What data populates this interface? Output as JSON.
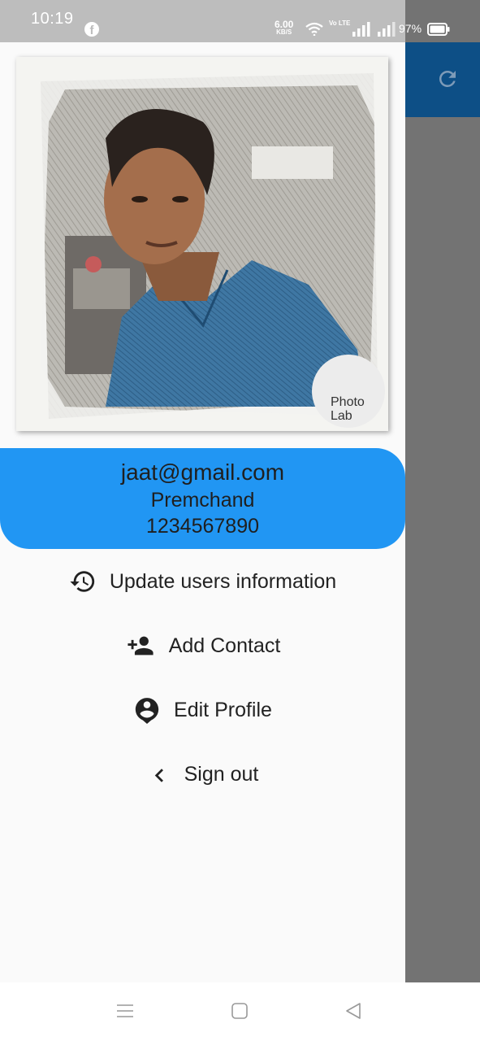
{
  "status_bar": {
    "time": "10:19",
    "speed_value": "6.00",
    "speed_unit": "KB/S",
    "volte": "Vo LTE",
    "battery_percent": "97%"
  },
  "user": {
    "email": "jaat@gmail.com",
    "name": "Premchand",
    "phone": "1234567890"
  },
  "photo": {
    "watermark_line1": "Photo",
    "watermark_line2": "Lab"
  },
  "menu": [
    {
      "label": "Update users information",
      "icon": "history-icon"
    },
    {
      "label": "Add Contact",
      "icon": "person-add-icon"
    },
    {
      "label": "Edit Profile",
      "icon": "account-circle-icon"
    },
    {
      "label": "Sign out",
      "icon": "chevron-left-icon"
    }
  ],
  "colors": {
    "app_bar": "#0d4f86",
    "user_card": "#2196f3",
    "drawer": "#fafafa",
    "scrim": "#737373"
  }
}
